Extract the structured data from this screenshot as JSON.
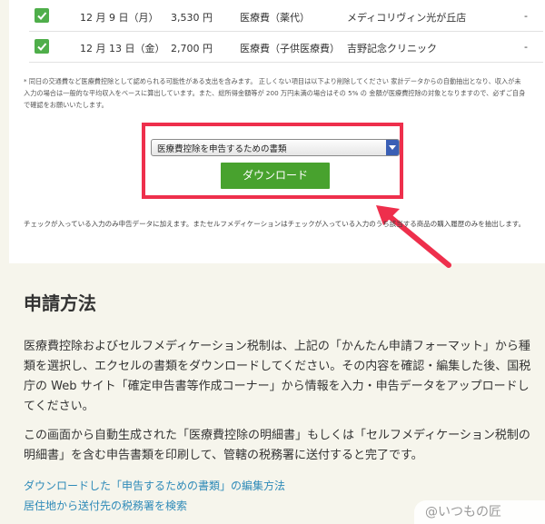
{
  "table": {
    "rows": [
      {
        "date": "12 月 9 日（月）",
        "amount": "3,530 円",
        "category": "医療費（薬代）",
        "provider": "メディコリヴィン光が丘店",
        "extra": "-"
      },
      {
        "date": "12 月 13 日（金）",
        "amount": "2,700 円",
        "category": "医療費（子供医療費）",
        "provider": "吉野記念クリニック",
        "extra": "-"
      }
    ]
  },
  "note": "* 同日の交通費など医療費控除として認められる可能性がある支出を含みます。 正しくない項目は以下より削除してください 家計データからの自動抽出となり、収入が未入力の場合は一般的な平均収入をベースに算出しています。また、総所得金額等が 200 万円未満の場合はその 5% の 金額が医療費控除の対象となりますので、必ずご自身で確認をお願いいたします。",
  "download": {
    "select_value": "医療費控除を申告するための書類",
    "button_label": "ダウンロード",
    "note": "チェックが入っている入力のみ申告データに加えます。またセルフメディケーションはチェックが入っている入力のうち該当する商品の購入履歴のみを抽出します。"
  },
  "section": {
    "title": "申請方法",
    "para1": "医療費控除およびセルフメディケーション税制は、上記の「かんたん申請フォーマット」から種類を選択し、エクセルの書類をダウンロードしてください。その内容を確認・編集した後、国税庁の Web サイト「確定申告書等作成コーナー」から情報を入力・申告データをアップロードしてください。",
    "para2": "この画面から自動生成された「医療費控除の明細書」もしくは「セルフメディケーション税制の明細書」を含む申告書類を印刷して、管轄の税務署に送付すると完了です。",
    "link1": "ダウンロードした「申告するための書類」の編集方法",
    "link2": "居住地から送付先の税務署を検索"
  },
  "watermark": "@いつもの匠",
  "colors": {
    "accent_green": "#48a22e",
    "highlight_red": "#ee2f4c",
    "link_blue": "#2e8ab8"
  }
}
